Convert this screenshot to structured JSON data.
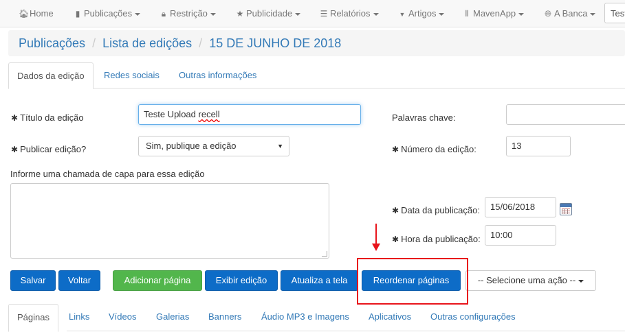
{
  "navbar": {
    "items": [
      {
        "label": "Home",
        "icon": "home-icon",
        "glyph": "🏠︎",
        "dropdown": false
      },
      {
        "label": "Publicações",
        "icon": "file-icon",
        "glyph": "▮",
        "dropdown": true
      },
      {
        "label": "Restrição",
        "icon": "lock-icon",
        "glyph": "🔒︎",
        "dropdown": true
      },
      {
        "label": "Publicidade",
        "icon": "star-icon",
        "glyph": "★",
        "dropdown": true
      },
      {
        "label": "Relatórios",
        "icon": "list-icon",
        "glyph": "☰",
        "dropdown": true
      },
      {
        "label": "Artigos",
        "icon": "bookmark-icon",
        "glyph": "▼",
        "dropdown": true
      },
      {
        "label": "MavenApp",
        "icon": "barcode-icon",
        "glyph": "⦀",
        "dropdown": true
      },
      {
        "label": "A Banca",
        "icon": "globe-icon",
        "glyph": "🌐︎",
        "dropdown": true
      }
    ],
    "search_value": "Teste"
  },
  "breadcrumb": [
    "Publicações",
    "Lista de edições",
    "15 DE JUNHO DE 2018"
  ],
  "top_tabs": [
    "Dados da edição",
    "Redes sociais",
    "Outras informações"
  ],
  "form": {
    "required_mark": "✱",
    "titulo_label": "Título da edição",
    "titulo_value": "Teste Upload",
    "titulo_value_misspelled": "recell",
    "publicar_label": "Publicar edição?",
    "publicar_value": "Sim, publique a edição",
    "chamada_label": "Informe uma chamada de capa para essa edição",
    "chamada_value": "",
    "palavras_label": "Palavras chave:",
    "palavras_value": "",
    "numero_label": "Número da edição:",
    "numero_value": "13",
    "data_label": "Data da publicação:",
    "data_value": "15/06/2018",
    "hora_label": "Hora da publicação:",
    "hora_value": "10:00"
  },
  "buttons": {
    "salvar": "Salvar",
    "voltar": "Voltar",
    "adicionar": "Adicionar página",
    "exibir": "Exibir edição",
    "atualiza": "Atualiza a tela",
    "reordenar": "Reordenar páginas",
    "acao": "-- Selecione uma ação --"
  },
  "bottom_tabs": [
    "Páginas",
    "Links",
    "Vídeos",
    "Galerias",
    "Banners",
    "Áudio MP3 e Imagens",
    "Aplicativos",
    "Outras configurações"
  ],
  "colors": {
    "primary": "#0d6cc7",
    "success": "#52b64c",
    "link": "#337ab7",
    "annotation": "#e8141b"
  }
}
